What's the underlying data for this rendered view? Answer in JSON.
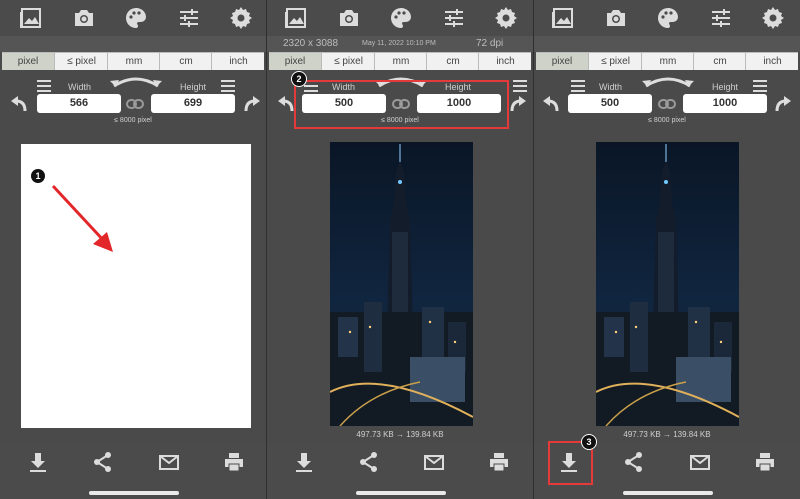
{
  "toolbar": {
    "icons": [
      "gallery-icon",
      "camera-icon",
      "palette-icon",
      "sliders-icon",
      "gear-icon"
    ]
  },
  "info": {
    "resolution": "2320 x 3088",
    "date": "May 11, 2022 10:10 PM",
    "dpi": "72 dpi"
  },
  "units": [
    "pixel",
    "≤ pixel",
    "mm",
    "cm",
    "inch"
  ],
  "selected_unit": "pixel",
  "labels": {
    "width": "Width",
    "height": "Height",
    "limit": "≤ 8000 pixel"
  },
  "panel1": {
    "width": "566",
    "height": "699",
    "step": "1"
  },
  "panel2": {
    "width": "500",
    "height": "1000",
    "step": "2",
    "size": "497.73 KB  →  139.84 KB"
  },
  "panel3": {
    "width": "500",
    "height": "1000",
    "step": "3",
    "size": "497.73 KB  →  139.84 KB"
  },
  "bottom_icons": [
    "download-icon",
    "share-icon",
    "mail-icon",
    "print-icon"
  ],
  "colors": {
    "highlight": "#e53a3a",
    "arrow": "#e3262a"
  }
}
